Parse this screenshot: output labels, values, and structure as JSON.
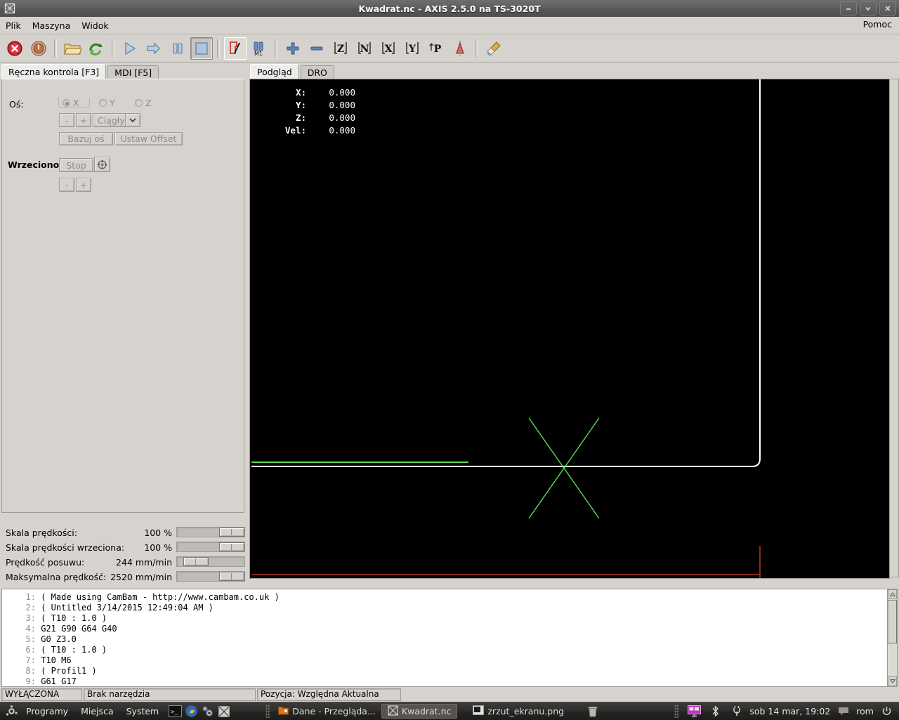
{
  "window": {
    "title": "Kwadrat.nc - AXIS 2.5.0 na TS-3020T",
    "app_icon": "axis-logo-icon",
    "minimize": "minimize-icon",
    "maximize": "maximize-icon",
    "close": "close-icon"
  },
  "menubar": {
    "items": [
      "Plik",
      "Maszyna",
      "Widok"
    ],
    "help": "Pomoc"
  },
  "toolbar": {
    "buttons": [
      {
        "name": "estop-toggle",
        "title": "E-Stop"
      },
      {
        "name": "machine-power-toggle",
        "title": "Wlacz maszyne"
      },
      {
        "name": "open-file-button",
        "title": "Otworz"
      },
      {
        "name": "reload-file-button",
        "title": "Przeladuj"
      },
      {
        "name": "run-program-button",
        "title": "Start"
      },
      {
        "name": "step-program-button",
        "title": "Krok"
      },
      {
        "name": "pause-program-button",
        "title": "Pauza"
      },
      {
        "name": "stop-program-button",
        "title": "Stop"
      },
      {
        "name": "toggle-block-delete-button",
        "title": "Pomijanie bloku"
      },
      {
        "name": "toggle-optional-stop-button",
        "title": "M1 opcjonalny stop"
      },
      {
        "name": "zoom-in-button",
        "title": "Powieksz"
      },
      {
        "name": "zoom-out-button",
        "title": "Pomniejsz"
      },
      {
        "name": "view-z-button",
        "title": "Widok Z"
      },
      {
        "name": "view-z2-button",
        "title": "Widok Z obrocony"
      },
      {
        "name": "view-x-button",
        "title": "Widok X"
      },
      {
        "name": "view-y-button",
        "title": "Widok Y"
      },
      {
        "name": "view-p-button",
        "title": "Widok perspektywiczny"
      },
      {
        "name": "tool-cone-button",
        "title": "Pokaz narzedzie"
      },
      {
        "name": "clear-backplot-button",
        "title": "Wyczysc slad"
      }
    ]
  },
  "left_panel": {
    "tabs": [
      {
        "label": "Ręczna kontrola [F3]",
        "active": true
      },
      {
        "label": "MDI [F5]",
        "active": false
      }
    ],
    "axis_label": "Oś:",
    "axes": [
      {
        "label": "X",
        "selected": true
      },
      {
        "label": "Y",
        "selected": false
      },
      {
        "label": "Z",
        "selected": false
      }
    ],
    "jog_minus": "-",
    "jog_plus": "+",
    "jog_mode": "Ciągły",
    "home_axis_button": "Bazuj oś",
    "set_offset_button": "Ustaw Offset",
    "spindle_label": "Wrzeciono:",
    "spindle_stop_button": "Stop",
    "spindle_icon": "spindle-icon",
    "spindle_minus": "-",
    "spindle_plus": "+"
  },
  "sliders": [
    {
      "name": "Skala prędkości:",
      "value": "100 %",
      "pos": 72
    },
    {
      "name": "Skala prędkości wrzeciona:",
      "value": "100 %",
      "pos": 72
    },
    {
      "name": "Prędkość posuwu:",
      "value": "244 mm/min",
      "pos": 9
    },
    {
      "name": "Maksymalna prędkość:",
      "value": "2520 mm/min",
      "pos": 86
    }
  ],
  "preview": {
    "tabs": [
      {
        "label": "Podgląd",
        "active": true
      },
      {
        "label": "DRO",
        "active": false
      }
    ],
    "dro": [
      {
        "key": "X:",
        "value": "0.000"
      },
      {
        "key": "Y:",
        "value": "0.000"
      },
      {
        "key": "Z:",
        "value": "0.000"
      },
      {
        "key": "Vel:",
        "value": "0.000"
      }
    ],
    "colors": {
      "background": "#000000",
      "toolpath_rapid": "#ffffff",
      "toolpath_feed": "#55dd55",
      "limits": "#aa3322"
    }
  },
  "gcode": {
    "lines": [
      {
        "n": "1:",
        "text": "( Made using CamBam - http://www.cambam.co.uk )"
      },
      {
        "n": "2:",
        "text": "( Untitled 3/14/2015 12:49:04 AM )"
      },
      {
        "n": "3:",
        "text": "( T10 : 1.0 )"
      },
      {
        "n": "4:",
        "text": "G21 G90 G64 G40"
      },
      {
        "n": "5:",
        "text": "G0 Z3.0"
      },
      {
        "n": "6:",
        "text": "( T10 : 1.0 )"
      },
      {
        "n": "7:",
        "text": "T10 M6"
      },
      {
        "n": "8:",
        "text": "( Profil1 )"
      },
      {
        "n": "9:",
        "text": "G61 G17"
      }
    ]
  },
  "statusbar": {
    "machine_state": "WYŁĄCZONA",
    "tool": "Brak narzędzia",
    "position": "Pozycja: Względna Aktualna"
  },
  "taskbar": {
    "menus": [
      "Programy",
      "Miejsca",
      "System"
    ],
    "launchers": [
      "terminal-icon",
      "firefox-icon",
      "settings-icon",
      "axis-icon"
    ],
    "tasks": [
      {
        "label": "Dane - Przegląda...",
        "icon": "folder-icon",
        "active": false
      },
      {
        "label": "Kwadrat.nc",
        "icon": "axis-icon",
        "active": true
      },
      {
        "label": "zrzut_ekranu.png",
        "icon": "image-viewer-icon",
        "active": false
      }
    ],
    "trash": "trash-icon",
    "tray": [
      "display-icon",
      "bluetooth-icon",
      "power-plug-icon"
    ],
    "clock": "sob 14 mar, 19:02",
    "user": "rom",
    "user_icon": "chat-icon",
    "shutdown": "power-icon"
  }
}
